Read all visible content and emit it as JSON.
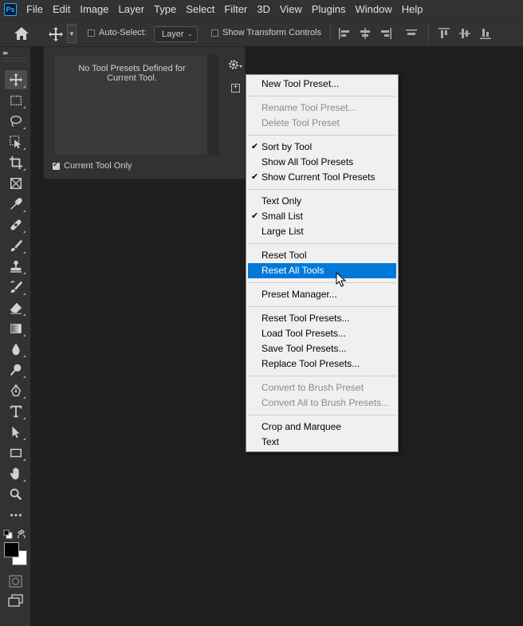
{
  "app": {
    "logo_text": "Ps",
    "accent": "#31a8ff"
  },
  "menubar": [
    "File",
    "Edit",
    "Image",
    "Layer",
    "Type",
    "Select",
    "Filter",
    "3D",
    "View",
    "Plugins",
    "Window",
    "Help"
  ],
  "options": {
    "auto_select_label": "Auto-Select:",
    "layer_value": "Layer",
    "show_transform_label": "Show Transform Controls"
  },
  "panel": {
    "empty_text": "No Tool Presets Defined for Current Tool.",
    "current_tool_only": "Current Tool Only"
  },
  "menu": {
    "highlight_color": "#0078d7",
    "items": [
      {
        "label": "New Tool Preset...",
        "enabled": true,
        "checked": false,
        "highlighted": false
      },
      {
        "label": "Rename Tool Preset...",
        "enabled": false,
        "checked": false,
        "highlighted": false
      },
      {
        "label": "Delete Tool Preset",
        "enabled": false,
        "checked": false,
        "highlighted": false
      },
      {
        "label": "Sort by Tool",
        "enabled": true,
        "checked": true,
        "highlighted": false
      },
      {
        "label": "Show All Tool Presets",
        "enabled": true,
        "checked": false,
        "highlighted": false
      },
      {
        "label": "Show Current Tool Presets",
        "enabled": true,
        "checked": true,
        "highlighted": false
      },
      {
        "label": "Text Only",
        "enabled": true,
        "checked": false,
        "highlighted": false
      },
      {
        "label": "Small List",
        "enabled": true,
        "checked": true,
        "highlighted": false
      },
      {
        "label": "Large List",
        "enabled": true,
        "checked": false,
        "highlighted": false
      },
      {
        "label": "Reset Tool",
        "enabled": true,
        "checked": false,
        "highlighted": false
      },
      {
        "label": "Reset All Tools",
        "enabled": true,
        "checked": false,
        "highlighted": true
      },
      {
        "label": "Preset Manager...",
        "enabled": true,
        "checked": false,
        "highlighted": false
      },
      {
        "label": "Reset Tool Presets...",
        "enabled": true,
        "checked": false,
        "highlighted": false
      },
      {
        "label": "Load Tool Presets...",
        "enabled": true,
        "checked": false,
        "highlighted": false
      },
      {
        "label": "Save Tool Presets...",
        "enabled": true,
        "checked": false,
        "highlighted": false
      },
      {
        "label": "Replace Tool Presets...",
        "enabled": true,
        "checked": false,
        "highlighted": false
      },
      {
        "label": "Convert to Brush Preset",
        "enabled": false,
        "checked": false,
        "highlighted": false
      },
      {
        "label": "Convert All to Brush Presets...",
        "enabled": false,
        "checked": false,
        "highlighted": false
      },
      {
        "label": "Crop and Marquee",
        "enabled": true,
        "checked": false,
        "highlighted": false
      },
      {
        "label": "Text",
        "enabled": true,
        "checked": false,
        "highlighted": false
      }
    ]
  },
  "tools": [
    "move-tool",
    "marquee-tool",
    "lasso-tool",
    "object-select-tool",
    "crop-tool",
    "frame-tool",
    "eyedropper-tool",
    "healing-brush-tool",
    "brush-tool",
    "clone-stamp-tool",
    "history-brush-tool",
    "eraser-tool",
    "gradient-tool",
    "blur-tool",
    "dodge-tool",
    "pen-tool",
    "type-tool",
    "path-select-tool",
    "rectangle-tool",
    "hand-tool",
    "zoom-tool",
    "more-tools"
  ],
  "colors": {
    "foreground": "#000000",
    "background": "#ffffff"
  }
}
